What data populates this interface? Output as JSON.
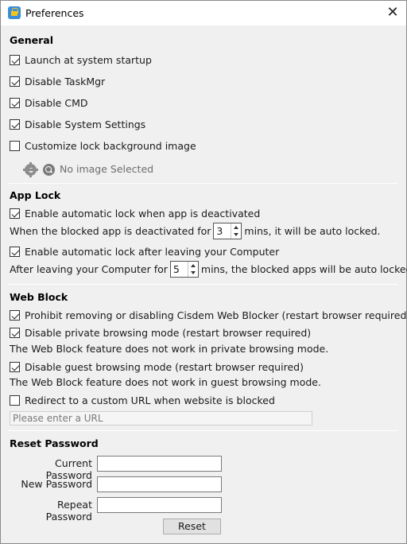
{
  "window": {
    "title": "Preferences"
  },
  "general": {
    "title": "General",
    "items": [
      {
        "label": "Launch at system startup",
        "checked": true
      },
      {
        "label": "Disable TaskMgr",
        "checked": true
      },
      {
        "label": "Disable CMD",
        "checked": true
      },
      {
        "label": "Disable System Settings",
        "checked": true
      },
      {
        "label": "Customize lock background image",
        "checked": false
      }
    ],
    "no_image_text": "No image Selected"
  },
  "app_lock": {
    "title": "App Lock",
    "auto_lock_deactivated": {
      "label": "Enable automatic lock when app is deactivated",
      "checked": true
    },
    "deactivated_prefix": "When the blocked app is deactivated for",
    "deactivated_value": "3",
    "deactivated_suffix": "mins, it will be auto locked.",
    "auto_lock_leaving": {
      "label": "Enable automatic lock after leaving your Computer",
      "checked": true
    },
    "leaving_prefix": "After leaving your Computer for",
    "leaving_value": "5",
    "leaving_suffix": "mins, the blocked apps will be auto locked."
  },
  "web_block": {
    "title": "Web Block",
    "prohibit": {
      "label": "Prohibit removing or disabling Cisdem Web Blocker (restart browser required)",
      "checked": true
    },
    "private": {
      "label": "Disable private browsing mode (restart browser required)",
      "checked": true
    },
    "private_note": "The Web Block feature does not work in private browsing mode.",
    "guest": {
      "label": "Disable guest browsing mode (restart browser required)",
      "checked": true
    },
    "guest_note": "The Web Block feature does not work in guest browsing mode.",
    "redirect": {
      "label": "Redirect to a custom URL when website is blocked",
      "checked": false
    },
    "url_placeholder": "Please enter a URL"
  },
  "reset_password": {
    "title": "Reset Password",
    "current_label": "Current Password",
    "new_label": "New Password",
    "repeat_label": "Repeat Password",
    "reset_label": "Reset"
  }
}
